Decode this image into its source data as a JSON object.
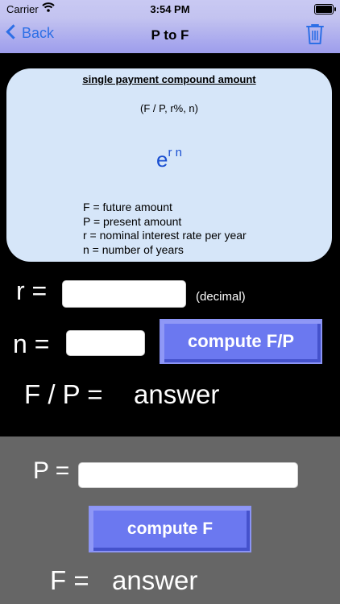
{
  "status_bar": {
    "carrier": "Carrier",
    "time": "3:54 PM"
  },
  "nav": {
    "back_label": "Back",
    "title": "P to F"
  },
  "formula_card": {
    "title": "single payment compound amount",
    "notation": "(F / P, r%, n)",
    "formula_base": "e",
    "formula_exponent": "r n",
    "legend": [
      "F = future amount",
      "P = present amount",
      "r = nominal interest rate per year",
      "n = number of years"
    ]
  },
  "inputs": {
    "r_label": "r =",
    "r_value": "",
    "r_unit": "(decimal)",
    "n_label": "n =",
    "n_value": "",
    "compute_fp_label": "compute F/P",
    "fp_label": "F / P =",
    "fp_answer": "answer"
  },
  "lower": {
    "p_label": "P =",
    "p_value": "",
    "compute_f_label": "compute F",
    "f_label": "F =",
    "f_answer": "answer"
  },
  "colors": {
    "nav_accent": "#2d6fe6",
    "button_fill": "#6b78f0",
    "card_bg": "#d6e6f9",
    "lower_panel_bg": "#666666"
  }
}
